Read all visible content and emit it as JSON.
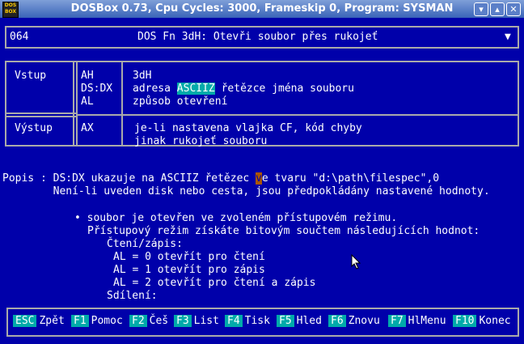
{
  "window": {
    "title": "DOSBox 0.73, Cpu Cycles:    3000, Frameskip  0, Program:   SYSMAN",
    "icon_label": "DOS BOX"
  },
  "header": {
    "number": "064",
    "title": "DOS Fn 3dH: Otevři soubor přes rukojeť",
    "dropdown": "▼"
  },
  "input": {
    "label": "Vstup",
    "reg1": "AH",
    "reg2": "DS:DX",
    "reg3": "AL",
    "desc1": "3dH",
    "desc2_pre": "adresa ",
    "desc2_hl": "ASCIIZ",
    "desc2_post": " řetězce jména souboru",
    "desc3": "způsob otevření"
  },
  "output": {
    "label": "Výstup",
    "reg": "AX",
    "desc1": "je-li nastavena vlajka CF, kód chyby",
    "desc2": "jinak rukojeť souboru"
  },
  "body": {
    "popis_pre": "Popis : DS:DX ukazuje na ASCIIZ řetězec ",
    "popis_cursor": "v",
    "popis_post": "e tvaru \"d:\\path\\filespec\",0",
    "line2": "        Není-li uveden disk nebo cesta, jsou předpokládány nastavené hodnoty.",
    "bullet": "• soubor je otevřen ve zvoleném přístupovém režimu.",
    "access": "Přístupový režim získáte bitovým součtem následujících hodnot:",
    "rw": "Čtení/zápis:",
    "al0": "AL = 0 otevřít pro čtení",
    "al1": "AL = 1 otevřít pro zápis",
    "al2": "AL = 2 otevřít pro čtení a zápis",
    "share": "Sdílení:"
  },
  "keys": [
    {
      "k": "ESC",
      "l": "Zpět"
    },
    {
      "k": "F1",
      "l": "Pomoc"
    },
    {
      "k": "F2",
      "l": "Češ"
    },
    {
      "k": "F3",
      "l": "List"
    },
    {
      "k": "F4",
      "l": "Tisk"
    },
    {
      "k": "F5",
      "l": "Hled"
    },
    {
      "k": "F6",
      "l": "Znovu"
    },
    {
      "k": "F7",
      "l": "HlMenu"
    },
    {
      "k": "F10",
      "l": "Konec"
    }
  ],
  "window_buttons": {
    "minimize": "▾",
    "maximize": "▴",
    "close": "✕"
  }
}
